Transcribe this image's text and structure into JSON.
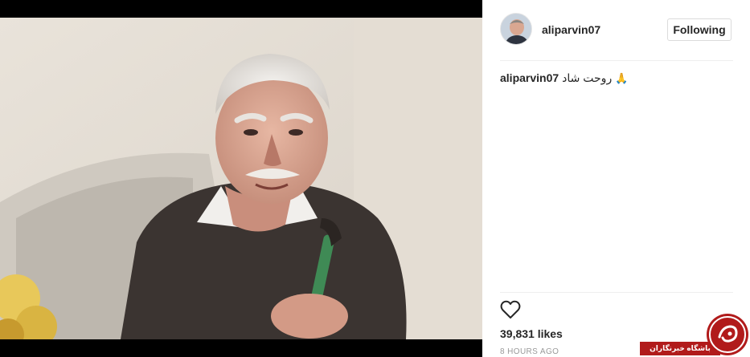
{
  "post": {
    "username": "aliparvin07",
    "follow_label": "Following",
    "caption_username": "aliparvin07",
    "caption_text": "روحت شاد",
    "caption_emoji": "🙏",
    "likes": "39,831 likes",
    "timestamp": "8 HOURS AGO"
  },
  "icons": {
    "like": "heart-outline-icon"
  },
  "watermark": {
    "text": "باشگاه خبرنگاران"
  },
  "colors": {
    "watermark_red": "#b11b1b",
    "border": "#dbdbdb",
    "text": "#262626",
    "muted": "#999999"
  }
}
